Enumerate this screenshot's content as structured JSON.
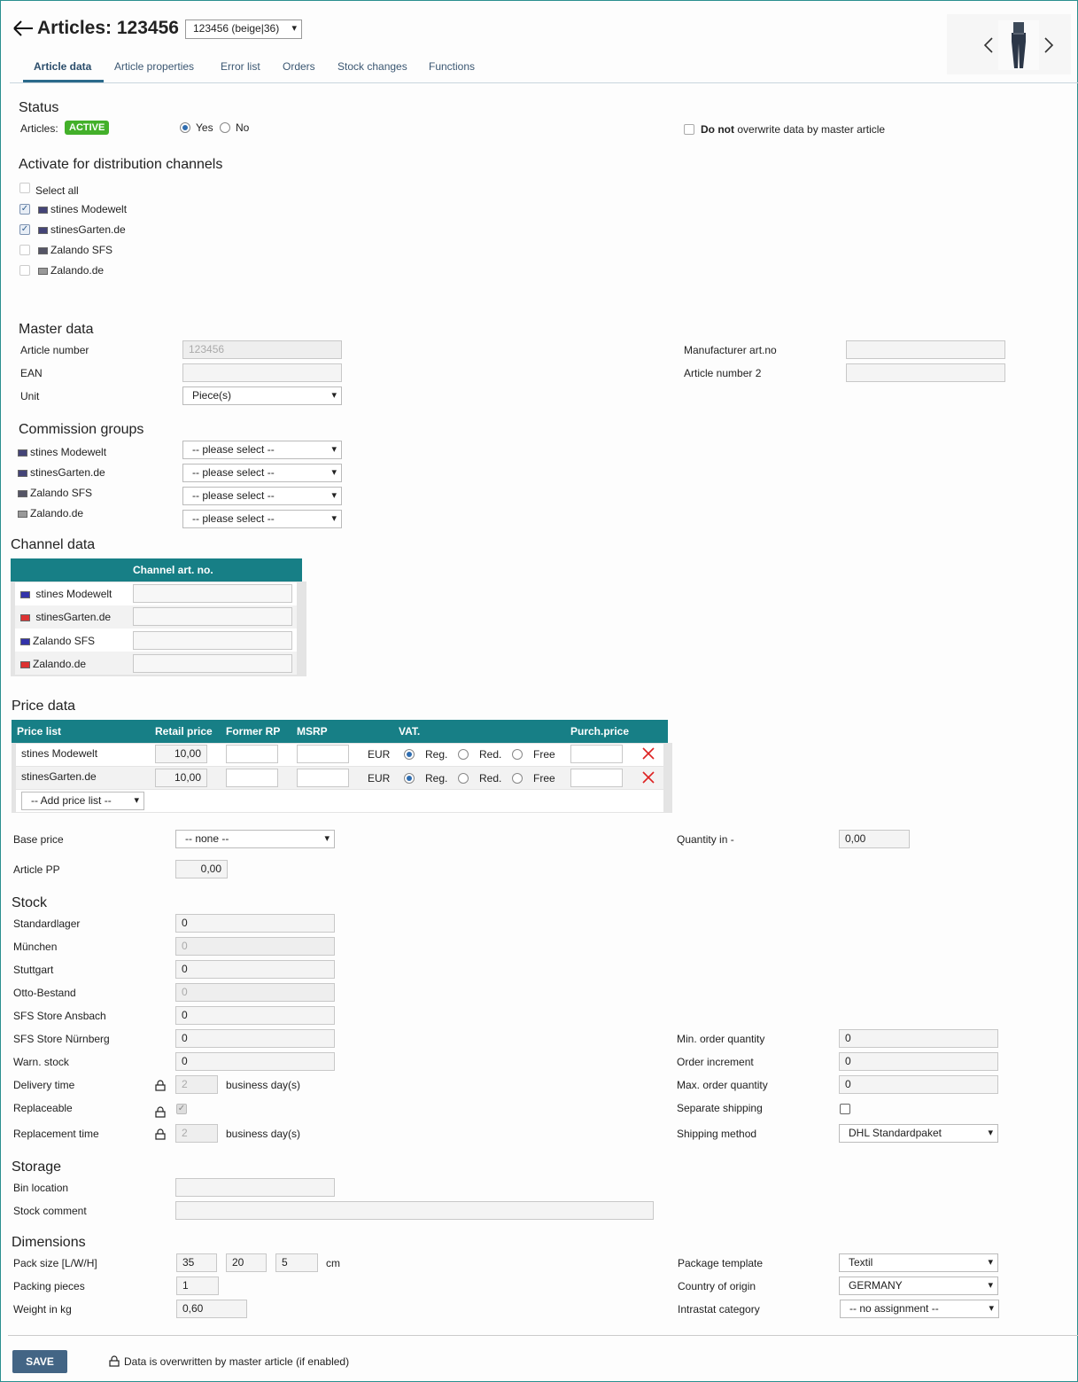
{
  "header": {
    "title": "Articles: 123456",
    "variant": "123456 (beige|36)"
  },
  "tabs": [
    {
      "label": "Article data"
    },
    {
      "label": "Article properties"
    },
    {
      "label": "Error list"
    },
    {
      "label": "Orders"
    },
    {
      "label": "Stock changes"
    },
    {
      "label": "Functions"
    }
  ],
  "status": {
    "heading": "Status",
    "articles_label": "Articles:",
    "badge": "ACTIVE",
    "yes": "Yes",
    "no": "No",
    "overwrite_bold": "Do not",
    "overwrite_rest": "overwrite data by master article"
  },
  "channels": {
    "heading": "Activate for distribution channels",
    "select_all": "Select all",
    "items": [
      {
        "name": "stines Modewelt",
        "checked": true
      },
      {
        "name": "stinesGarten.de",
        "checked": true
      },
      {
        "name": "Zalando SFS",
        "checked": false
      },
      {
        "name": "Zalando.de",
        "checked": false
      }
    ]
  },
  "master": {
    "heading": "Master data",
    "article_number_label": "Article number",
    "article_number": "123456",
    "ean_label": "EAN",
    "unit_label": "Unit",
    "unit": "Piece(s)",
    "manufacturer_label": "Manufacturer art.no",
    "article_number2_label": "Article number 2"
  },
  "commission": {
    "heading": "Commission groups",
    "placeholder": "-- please select --",
    "channels": [
      "stines Modewelt",
      "stinesGarten.de",
      "Zalando SFS",
      "Zalando.de"
    ]
  },
  "channel_data": {
    "heading": "Channel data",
    "column": "Channel art. no.",
    "rows": [
      "stines Modewelt",
      "stinesGarten.de",
      "Zalando SFS",
      "Zalando.de"
    ]
  },
  "price": {
    "heading": "Price data",
    "cols": [
      "Price list",
      "Retail price",
      "Former RP",
      "MSRP",
      "VAT.",
      "Purch.price"
    ],
    "rows": [
      {
        "name": "stines Modewelt",
        "retail": "10,00",
        "currency": "EUR"
      },
      {
        "name": "stinesGarten.de",
        "retail": "10,00",
        "currency": "EUR"
      }
    ],
    "vat_options": [
      "Reg.",
      "Red.",
      "Free"
    ],
    "add": "-- Add price list --"
  },
  "base": {
    "base_price_label": "Base price",
    "base_price": "-- none --",
    "quantity_label": "Quantity in",
    "quantity_suffix": "-",
    "quantity": "0,00",
    "pp_label": "Article PP",
    "pp": "0,00"
  },
  "stock": {
    "heading": "Stock",
    "rows": [
      {
        "label": "Standardlager",
        "value": "0"
      },
      {
        "label": "München",
        "value": "0"
      },
      {
        "label": "Stuttgart",
        "value": "0"
      },
      {
        "label": "Otto-Bestand",
        "value": "0"
      },
      {
        "label": "SFS Store Ansbach",
        "value": "0"
      },
      {
        "label": "SFS Store Nürnberg",
        "value": "0"
      },
      {
        "label": "Warn. stock",
        "value": "0"
      }
    ],
    "delivery_label": "Delivery time",
    "delivery": "2",
    "days": "business day(s)",
    "replaceable_label": "Replaceable",
    "replacement_label": "Replacement time",
    "replacement": "2",
    "min_label": "Min. order quantity",
    "min": "0",
    "inc_label": "Order increment",
    "inc": "0",
    "max_label": "Max. order quantity",
    "max": "0",
    "separate_label": "Separate shipping",
    "shipping_label": "Shipping method",
    "shipping": "DHL Standardpaket"
  },
  "storage": {
    "heading": "Storage",
    "bin_label": "Bin location",
    "comment_label": "Stock comment"
  },
  "dims": {
    "heading": "Dimensions",
    "pack_label": "Pack size [L/W/H]",
    "l": "35",
    "w": "20",
    "h": "5",
    "unit": "cm",
    "pieces_label": "Packing pieces",
    "pieces": "1",
    "weight_label": "Weight in kg",
    "weight": "0,60",
    "template_label": "Package template",
    "template": "Textil",
    "country_label": "Country of origin",
    "country": "GERMANY",
    "intrastat_label": "Intrastat category",
    "intrastat": "-- no assignment --"
  },
  "footer": {
    "save": "SAVE",
    "note": "Data is overwritten by master article (if enabled)"
  }
}
